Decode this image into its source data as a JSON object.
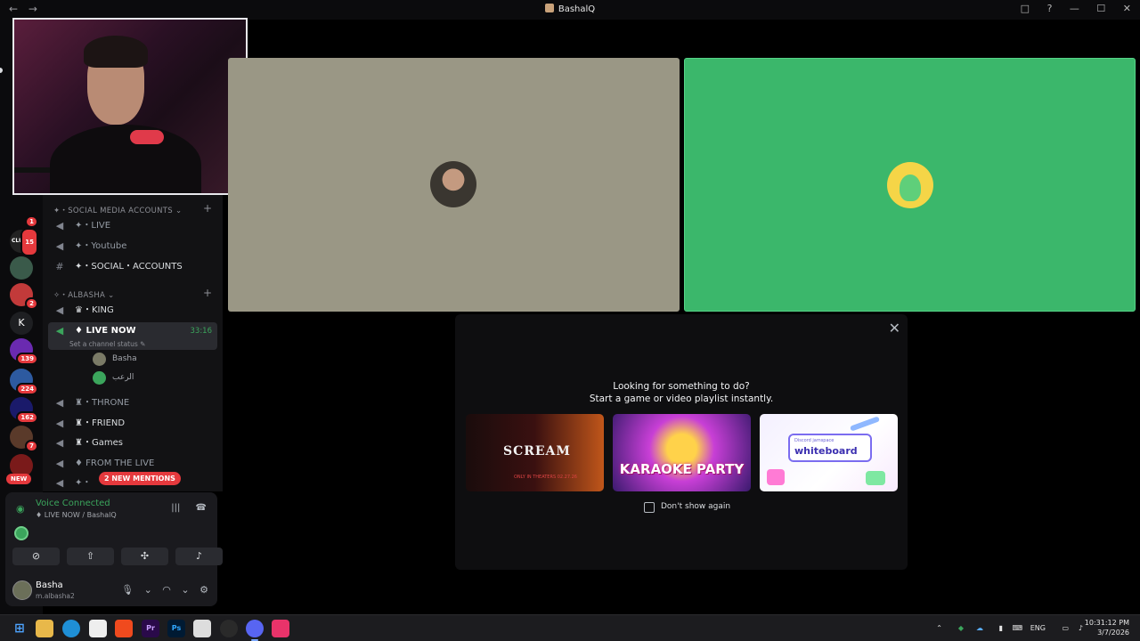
{
  "titlebar": {
    "title": "BashalQ",
    "back": "←",
    "forward": "→",
    "icons": {
      "inbox": "□",
      "help": "?",
      "minimize": "—",
      "maximize": "☐",
      "close": "✕"
    }
  },
  "servers": [
    {
      "name": "server-1",
      "badge": "1",
      "color": "#1fa0d8"
    },
    {
      "name": "server-clubb",
      "badge": "15",
      "color": "#222",
      "label": "CLUBB"
    },
    {
      "name": "server-3",
      "badge": "",
      "color": "#3a5a4a"
    },
    {
      "name": "server-4",
      "badge": "2",
      "color": "#c23a3a"
    },
    {
      "name": "server-k",
      "badge": "",
      "color": "#1e1f22",
      "label": "K"
    },
    {
      "name": "server-6",
      "badge": "139",
      "color": "#6a2ab0"
    },
    {
      "name": "server-7",
      "badge": "224",
      "color": "#2d5aa0"
    },
    {
      "name": "server-8",
      "badge": "162",
      "color": "#1a1a6a"
    },
    {
      "name": "server-9",
      "badge": "7",
      "color": "#5a3a2a"
    },
    {
      "name": "server-10",
      "badge": "",
      "color": "#7a1a1a"
    }
  ],
  "new_label": "NEW",
  "categories": {
    "social": "✦・SOCIAL MEDIA ACCOUNTS ⌄",
    "albasha": "✧・ALBASHA ⌄"
  },
  "channels": {
    "live": "✦・LIVE",
    "youtube": "✦・Youtube",
    "social_accounts": "✦・SOCIAL・ACCOUNTS",
    "king": "♛・KING",
    "live_now": "♦ LIVE NOW",
    "live_now_time": "33:16",
    "live_now_status": "Set a channel status ✎",
    "throne": "♜・THRONE",
    "friend": "♜・FRIEND",
    "games": "♜・Games",
    "from_the_live": "♦ FROM THE LIVE",
    "last": "✦・"
  },
  "voice_users": [
    {
      "name": "Basha"
    },
    {
      "name": "الرعب"
    }
  ],
  "mentions_label": "2 NEW MENTIONS",
  "voice": {
    "status": "Voice Connected",
    "location": "♦ LIVE NOW / BashalQ"
  },
  "user": {
    "name": "Basha",
    "tag": "m.albasha2"
  },
  "popup": {
    "line1": "Looking for something to do?",
    "line2": "Start a game or video playlist instantly.",
    "dont_show": "Don't show again",
    "cards": {
      "scream": "SCREAM",
      "scream_date": "ONLY IN THEATERS 02.27.26",
      "karaoke": "KARAOKE PARTY",
      "whiteboard_small": "Discord jamspace",
      "whiteboard": "whiteboard"
    }
  },
  "taskbar": {
    "lang": "ENG",
    "time": "10:31:12 PM",
    "date": "3/7/2026"
  }
}
